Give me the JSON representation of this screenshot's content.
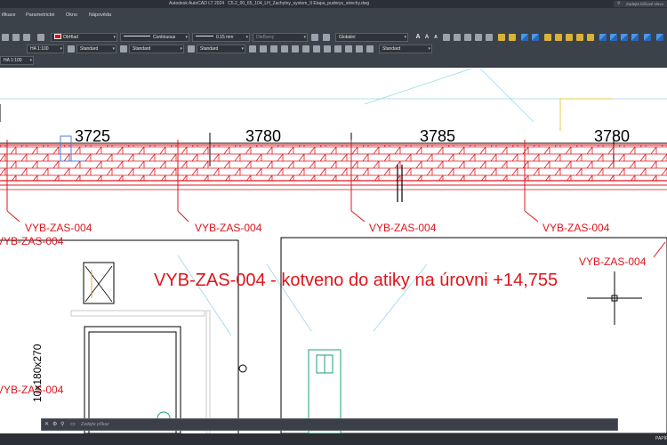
{
  "window": {
    "app_title": "Autodesk AutoCAD LT 2024",
    "file_title": "C5.2_00_65_104_LH_Zachytny_system_II Etapa_pudorys_strechy.dwg",
    "search_placeholder": "Zadejte klíčové slovo"
  },
  "menu": {
    "items": [
      "ifikace",
      "Parametrické",
      "Okno",
      "Nápověda"
    ]
  },
  "ribbon": {
    "color_combo": "ObHlad",
    "linetype_combo": "Continuous",
    "lineweight_combo": "0.15 mm",
    "plotstyle_combo": "DleBarvy",
    "ucs_combo": "Globální",
    "dimscale_combo": "HA 1:100",
    "textstyle_combo": "Standard",
    "dimstyle_combo": "Standard",
    "tablestyle_combo": "Standard",
    "mleaderstyle_combo": "Standard",
    "annoscale_combo": "HA 1:100",
    "text_height_buttons": [
      "A",
      "A",
      "A"
    ],
    "accent_color": "#e01010"
  },
  "drawing": {
    "dimensions": [
      "3725",
      "3780",
      "3785",
      "3780"
    ],
    "anchor_tags": [
      "VYB-ZAS-004",
      "VYB-ZAS-004",
      "VYB-ZAS-004",
      "VYB-ZAS-004",
      "VYB-ZAS-004",
      "VYB-ZAS-004",
      "VYB-ZAS-004"
    ],
    "note": "VYB-ZAS-004  - kotveno do atiky na úrovni +14,755",
    "vertical_label": "10x180x270",
    "note_color": "#e0141c"
  },
  "command_line": {
    "prompt": "Zadejte  příkaz"
  },
  "status_bar": {
    "paper_label": "PAPÍR"
  }
}
